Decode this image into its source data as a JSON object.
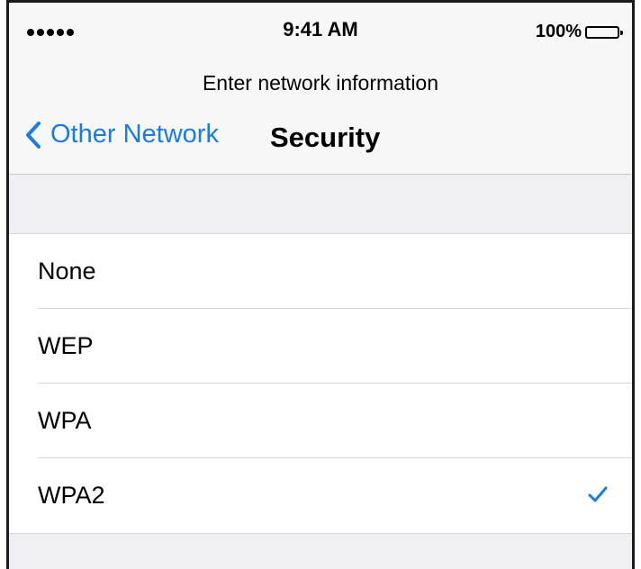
{
  "status_bar": {
    "time": "9:41 AM",
    "battery_percent": "100%",
    "battery_level": 1.0,
    "signal_dots": 5
  },
  "nav": {
    "prompt": "Enter network information",
    "back_label": "Other Network",
    "title": "Security"
  },
  "options": [
    {
      "label": "None",
      "selected": false
    },
    {
      "label": "WEP",
      "selected": false
    },
    {
      "label": "WPA",
      "selected": false
    },
    {
      "label": "WPA2",
      "selected": true
    }
  ],
  "icons": {
    "back": "chevron-left-icon",
    "selected": "checkmark-icon"
  },
  "colors": {
    "accent": "#1b7be4",
    "background": "#efeff4",
    "bar": "#f7f7f7",
    "separator": "#d8d8dc"
  }
}
